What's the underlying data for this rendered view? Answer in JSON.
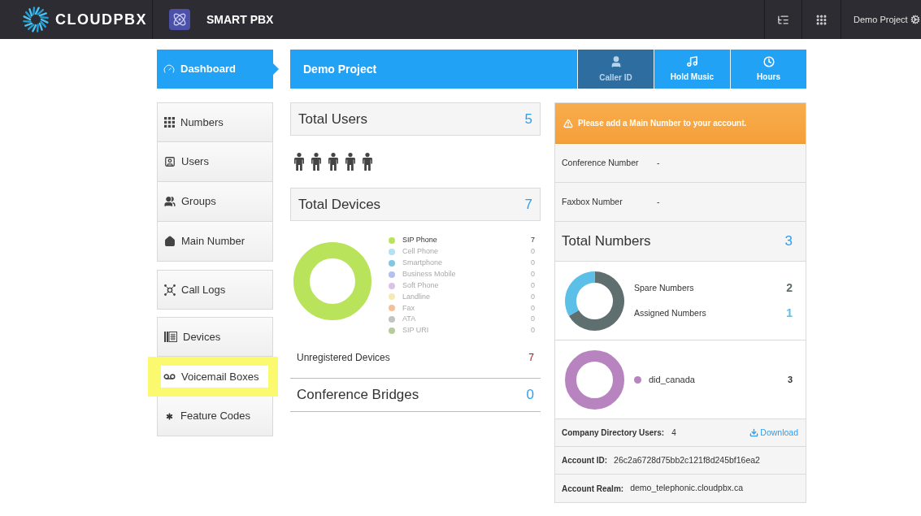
{
  "top_bar": {
    "logo_text": "CLOUDPBX",
    "app_name": "SMART PBX",
    "project": "Demo Project"
  },
  "sidebar": {
    "groups": [
      {
        "items": [
          {
            "label": "Dashboard",
            "selected": true,
            "highlighted": false
          }
        ]
      },
      {
        "items": [
          {
            "label": "Numbers",
            "selected": false,
            "highlighted": false
          },
          {
            "label": "Users",
            "selected": false,
            "highlighted": false
          },
          {
            "label": "Groups",
            "selected": false,
            "highlighted": false
          },
          {
            "label": "Main Number",
            "selected": false,
            "highlighted": false
          }
        ]
      },
      {
        "items": [
          {
            "label": "Call Logs",
            "selected": false,
            "highlighted": false
          }
        ]
      },
      {
        "items": [
          {
            "label": "Devices",
            "selected": false,
            "highlighted": false
          },
          {
            "label": "Voicemail Boxes",
            "selected": false,
            "highlighted": true
          },
          {
            "label": "Feature Codes",
            "selected": false,
            "highlighted": false
          }
        ]
      }
    ]
  },
  "header": {
    "title": "Demo Project",
    "tabs": [
      {
        "label": "Caller ID",
        "selected": true
      },
      {
        "label": "Hold Music",
        "selected": false
      },
      {
        "label": "Hours",
        "selected": false
      }
    ]
  },
  "total_users": {
    "label": "Total Users",
    "value": "5"
  },
  "total_devices": {
    "label": "Total Devices",
    "value": "7",
    "legend": [
      {
        "label": "SIP Phone",
        "count": "7",
        "color": "#b9e35a",
        "dimmed": false
      },
      {
        "label": "Cell Phone",
        "count": "0",
        "color": "#b3e0f4",
        "dimmed": true
      },
      {
        "label": "Smartphone",
        "count": "0",
        "color": "#80c7e6",
        "dimmed": true
      },
      {
        "label": "Business Mobile",
        "count": "0",
        "color": "#b4bff4",
        "dimmed": true
      },
      {
        "label": "Soft Phone",
        "count": "0",
        "color": "#dac3e4",
        "dimmed": true
      },
      {
        "label": "Landline",
        "count": "0",
        "color": "#f5ebb2",
        "dimmed": true
      },
      {
        "label": "Fax",
        "count": "0",
        "color": "#f5c096",
        "dimmed": true
      },
      {
        "label": "ATA",
        "count": "0",
        "color": "#c0c4c4",
        "dimmed": true
      },
      {
        "label": "SIP URI",
        "count": "0",
        "color": "#b6cc9c",
        "dimmed": true
      }
    ]
  },
  "unregistered_devices": {
    "label": "Unregistered Devices",
    "value": "7"
  },
  "conference_bridges": {
    "label": "Conference Bridges",
    "value": "0"
  },
  "alert": {
    "text": "Please add a Main Number to your account."
  },
  "info_rows": [
    {
      "label": "Conference Number",
      "value": "-"
    },
    {
      "label": "Faxbox Number",
      "value": "-"
    }
  ],
  "total_numbers": {
    "label": "Total Numbers",
    "value": "3"
  },
  "number_status": {
    "chart_data": {
      "type": "donut",
      "categories": [
        "Spare Numbers",
        "Assigned Numbers"
      ],
      "values": [
        66.7,
        33.3
      ]
    },
    "items": [
      {
        "value": "2",
        "color": "#5f6e6e"
      },
      {
        "value": "1",
        "color": "#5bbfe8"
      }
    ]
  },
  "number_types": {
    "items": [
      {
        "label": "did_canada",
        "value": "3",
        "color": "#b784bf"
      }
    ]
  },
  "directory": {
    "label": "Company Directory Users:",
    "value": "4",
    "download": "Download"
  },
  "account_rows": [
    {
      "label": "Account ID:",
      "value": "26c2a6728d75bb2c121f8d245bf16ea2"
    },
    {
      "label": "Account Realm:",
      "value": "demo_telephonic.cloudpbx.ca"
    }
  ]
}
